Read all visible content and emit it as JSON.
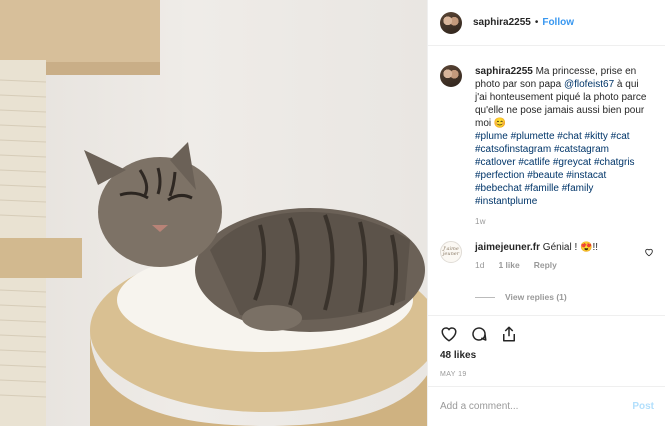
{
  "header": {
    "username": "saphira2255",
    "separator": "•",
    "follow_label": "Follow"
  },
  "caption": {
    "username": "saphira2255",
    "text_before": " Ma princesse, prise en photo par son papa ",
    "mention": "@flofeist67",
    "text_after": " à qui j'ai honteusement piqué la photo parce qu'elle ne pose jamais aussi bien pour moi 😊",
    "hashtags": [
      "#plume",
      "#plumette",
      "#chat",
      "#kitty",
      "#cat",
      "#catsofinstagram",
      "#catstagram",
      "#catlover",
      "#catlife",
      "#greycat",
      "#chatgris",
      "#perfection",
      "#beaute",
      "#instacat",
      "#bebechat",
      "#famille",
      "#family",
      "#instantplume"
    ],
    "time": "1w"
  },
  "comment": {
    "avatar_text": "J'aime jeuner",
    "username": "jaimejeuner.fr",
    "text": " Génial ! 😍!!",
    "time": "1d",
    "likes": "1 like",
    "reply_label": "Reply"
  },
  "view_replies": "View replies (1)",
  "actions": {
    "like_icon": "heart-icon",
    "comment_icon": "comment-icon",
    "share_icon": "share-icon"
  },
  "likes_text": "48 likes",
  "date_text": "MAY 19",
  "add_comment": {
    "placeholder": "Add a comment...",
    "post_label": "Post"
  },
  "colors": {
    "accent": "#3897f0",
    "post_disabled": "#b2dffc",
    "hashtag": "#003569"
  }
}
